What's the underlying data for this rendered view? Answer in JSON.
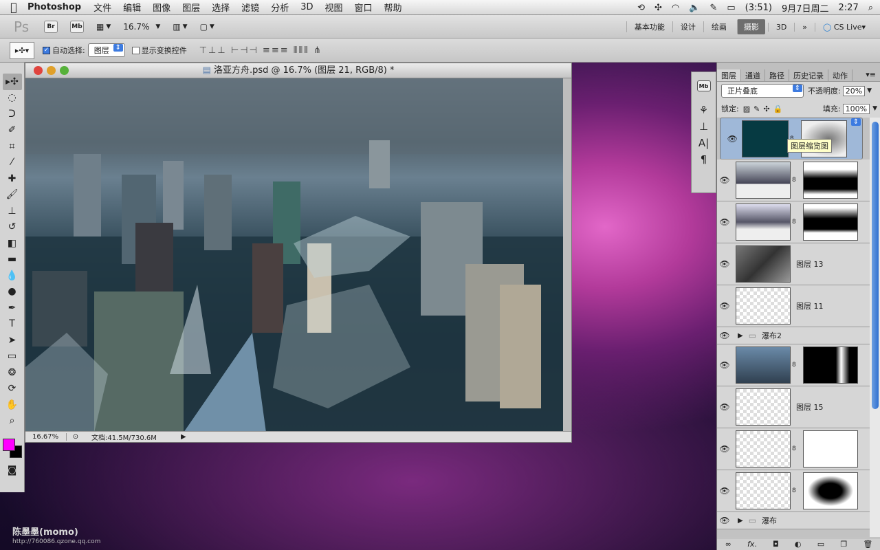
{
  "menubar": {
    "app": "Photoshop",
    "items": [
      "文件",
      "编辑",
      "图像",
      "图层",
      "选择",
      "滤镜",
      "分析",
      "3D",
      "视图",
      "窗口",
      "帮助"
    ],
    "battery": "(3:51)",
    "date": "9月7日周二",
    "time": "2:27"
  },
  "appbar": {
    "ps": "Ps",
    "br": "Br",
    "mb": "Mb",
    "zoom": "16.7%",
    "workspaces": [
      "基本功能",
      "设计",
      "绘画",
      "摄影",
      "3D"
    ],
    "active_workspace": "摄影",
    "cslive": "CS Live"
  },
  "optbar": {
    "auto_select": "自动选择:",
    "auto_select_value": "图层",
    "show_transform": "显示变换控件"
  },
  "document": {
    "title": "洛亚方舟.psd @ 16.7% (图层 21, RGB/8) *",
    "zoom": "16.67%",
    "docsize": "文档:41.5M/730.6M"
  },
  "dock": {
    "mb": "Mb"
  },
  "layers": {
    "tabs": [
      "图层",
      "通道",
      "路径",
      "历史记录",
      "动作"
    ],
    "blend_mode": "正片叠底",
    "opacity_label": "不透明度:",
    "opacity": "20%",
    "lock_label": "锁定:",
    "fill_label": "填充:",
    "fill": "100%",
    "tooltip": "图层缩览图",
    "items": [
      {
        "name": "",
        "thumb": "#063a42",
        "mask": "cloud",
        "selected": true
      },
      {
        "name": "",
        "thumb": "city",
        "mask": "bw"
      },
      {
        "name": "",
        "thumb": "city",
        "mask": "bw"
      },
      {
        "name": "图层 13",
        "thumb": "gray"
      },
      {
        "name": "图层 11",
        "thumb": "checker"
      },
      {
        "name": "瀑布2",
        "group": true
      },
      {
        "name": "",
        "thumb": "city2",
        "mask": "blk"
      },
      {
        "name": "图层 15",
        "thumb": "checker"
      },
      {
        "name": "",
        "thumb": "checker",
        "mask": "wht"
      },
      {
        "name": "",
        "thumb": "checker",
        "mask": "wht"
      },
      {
        "name": "瀑布",
        "group": true
      }
    ]
  },
  "watermark": {
    "name": "陈墨墨(momo)",
    "url": "http://760086.qzone.qq.com"
  },
  "colors": {
    "foreground": "#ff00ff",
    "background": "#000000"
  }
}
